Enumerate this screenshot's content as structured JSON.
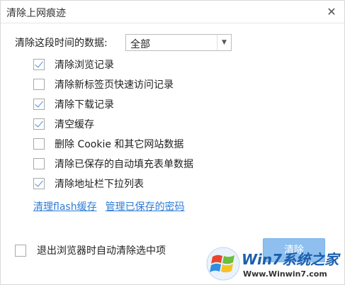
{
  "window": {
    "title": "清除上网痕迹",
    "close_glyph": "✕"
  },
  "time_range": {
    "label": "清除这段时间的数据:",
    "value": "全部"
  },
  "options": [
    {
      "label": "清除浏览记录",
      "checked": true
    },
    {
      "label": "清除新标签页快速访问记录",
      "checked": false
    },
    {
      "label": "清除下载记录",
      "checked": true
    },
    {
      "label": "清空缓存",
      "checked": true
    },
    {
      "label": "删除 Cookie 和其它网站数据",
      "checked": false
    },
    {
      "label": "清除已保存的自动填充表单数据",
      "checked": false
    },
    {
      "label": "清除地址栏下拉列表",
      "checked": true
    }
  ],
  "links": {
    "flash": "清理flash缓存",
    "passwords": "管理已保存的密码"
  },
  "auto_clear": {
    "label": "退出浏览器时自动清除选中项",
    "checked": false
  },
  "actions": {
    "clear_label": "清除"
  },
  "watermark": {
    "brand": "Win7系统之家",
    "url": "Www.Winwin7.com"
  },
  "colors": {
    "accent": "#2f7cd6",
    "button": "#8ebfee",
    "check": "#4a90d9",
    "brand": "#1b5fae"
  }
}
